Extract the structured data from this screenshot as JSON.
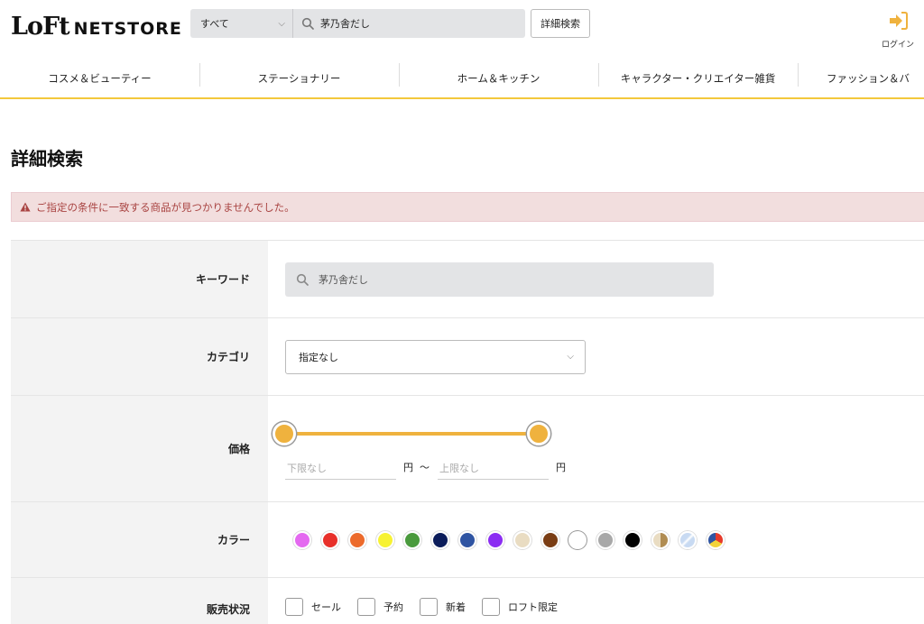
{
  "header": {
    "logo_mark": "LoFt",
    "logo_text": "NETSTORE",
    "search_scope": "すべて",
    "search_value": "茅乃舎だし",
    "advanced_search_label": "詳細検索",
    "login_label": "ログイン",
    "login_icon": "login-arrow-icon",
    "accent_color": "#efb23e"
  },
  "nav": {
    "items": [
      "コスメ＆ビューティー",
      "ステーショナリー",
      "ホーム＆キッチン",
      "キャラクター・クリエイター雑貨",
      "ファッション＆バ"
    ]
  },
  "page": {
    "title": "詳細検索",
    "alert_text": "ご指定の条件に一致する商品が見つかりませんでした。"
  },
  "form": {
    "keyword": {
      "label": "キーワード",
      "value": "茅乃舎だし"
    },
    "category": {
      "label": "カテゴリ",
      "value": "指定なし"
    },
    "price": {
      "label": "価格",
      "min_placeholder": "下限なし",
      "max_placeholder": "上限なし",
      "unit": "円",
      "separator": "〜"
    },
    "color": {
      "label": "カラー",
      "swatches": [
        {
          "name": "pink",
          "color": "#e469f0"
        },
        {
          "name": "red",
          "color": "#e8302a"
        },
        {
          "name": "orange",
          "color": "#ec6a2b"
        },
        {
          "name": "yellow",
          "color": "#f7f233"
        },
        {
          "name": "green",
          "color": "#4a9a3d"
        },
        {
          "name": "navy",
          "color": "#0b1c5a"
        },
        {
          "name": "blue",
          "color": "#2f54a2"
        },
        {
          "name": "purple",
          "color": "#8b2df2"
        },
        {
          "name": "beige",
          "color": "#e9dcc2"
        },
        {
          "name": "brown",
          "color": "#7a3d14"
        },
        {
          "name": "white",
          "color": "#ffffff"
        },
        {
          "name": "gray",
          "color": "#a8a8a8"
        },
        {
          "name": "black",
          "color": "#000000"
        },
        {
          "name": "gold",
          "color": "#c8a466"
        },
        {
          "name": "silver",
          "color": "#d5e4f5"
        },
        {
          "name": "multi",
          "color": "#e63a2b"
        }
      ]
    },
    "sales_status": {
      "label": "販売状況",
      "options": [
        "セール",
        "予約",
        "新着",
        "ロフト限定"
      ]
    }
  }
}
